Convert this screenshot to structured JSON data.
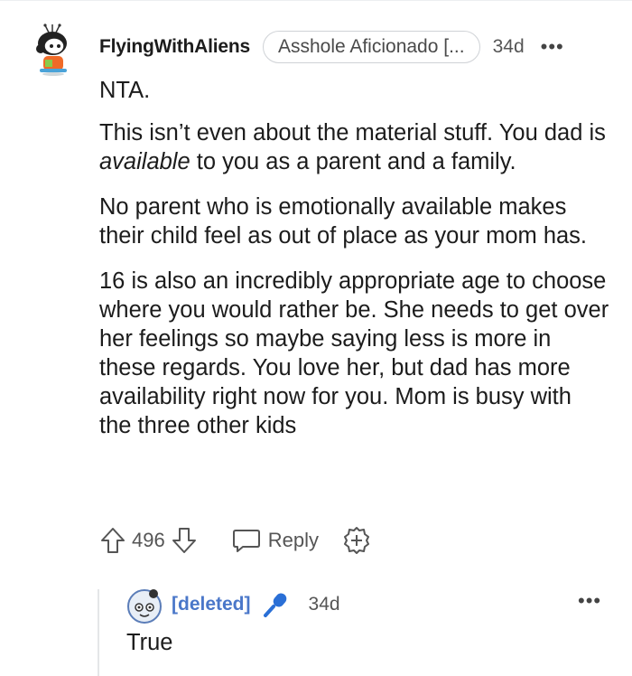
{
  "comment": {
    "username": "FlyingWithAliens",
    "flair": "Asshole Aficionado [...",
    "age": "34d",
    "more_label": "•••",
    "paragraphs": {
      "p1": "NTA.",
      "p2_before": "This isn’t even about the material stuff. You dad is ",
      "p2_em": "available",
      "p2_after": " to you as a parent and a family.",
      "p3": "No parent who is emotionally available makes their child feel as out of place as your mom has.",
      "p4": "16 is also an incredibly appropriate age to choose where you would rather be. She needs to get over her feelings so maybe saying less is more in these regards. You love her, but dad has more availability right now for you. Mom is busy with the three other kids"
    },
    "actions": {
      "score": "496",
      "reply_label": "Reply"
    }
  },
  "reply": {
    "username": "[deleted]",
    "age": "34d",
    "more_label": "•••",
    "text": "True"
  },
  "colors": {
    "text": "#1c1c1c",
    "muted": "#555555",
    "deleted_user": "#4a77c9",
    "mic_icon": "#2a6fd6",
    "thread_line": "#e4e6e8"
  },
  "icons": {
    "upvote": "upvote-arrow-icon",
    "downvote": "downvote-arrow-icon",
    "reply": "speech-bubble-icon",
    "award": "award-plus-icon",
    "mic": "microphone-icon"
  }
}
